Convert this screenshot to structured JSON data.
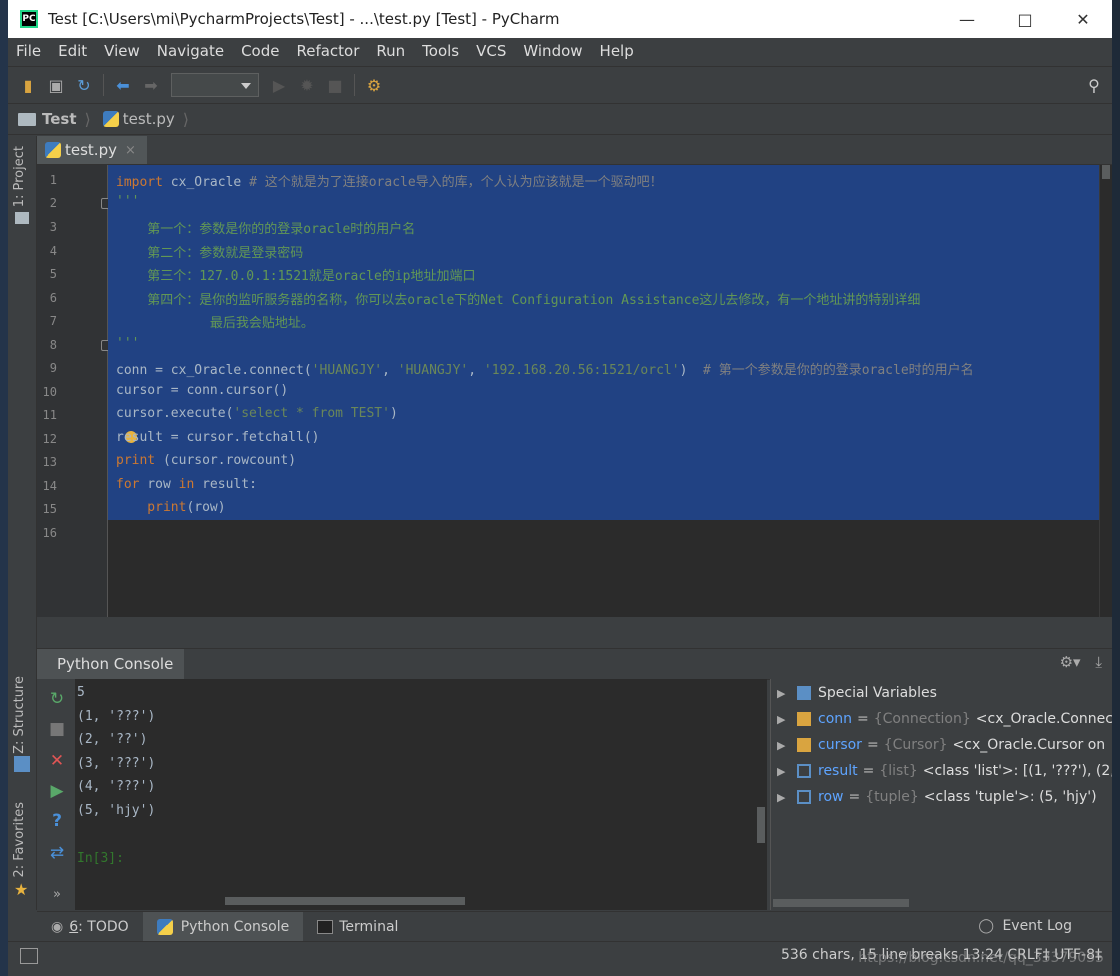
{
  "window": {
    "title": "Test [C:\\Users\\mi\\PycharmProjects\\Test] - ...\\test.py [Test] - PyCharm",
    "app_icon": "pycharm-logo",
    "app_icon_text": "PC",
    "controls": [
      "minimize-icon",
      "maximize-icon",
      "close-icon"
    ]
  },
  "menu": [
    "File",
    "Edit",
    "View",
    "Navigate",
    "Code",
    "Refactor",
    "Run",
    "Tools",
    "VCS",
    "Window",
    "Help"
  ],
  "toolbar": {
    "icons": [
      "open-folder-icon",
      "save-icon",
      "sync-icon",
      "back-arrow-icon",
      "forward-arrow-icon",
      "run-config-dropdown",
      "run-icon",
      "debug-icon",
      "stop-icon",
      "settings-icon",
      "search-icon"
    ]
  },
  "breadcrumb": {
    "project": "Test",
    "file": "test.py"
  },
  "left_strip": {
    "project_tab": "1: Project",
    "structure_tab": "Z: Structure",
    "favorites_tab": "2: Favorites"
  },
  "editor": {
    "tab_label": "test.py",
    "tab_close": "×",
    "line_numbers": [
      "1",
      "2",
      "3",
      "4",
      "5",
      "6",
      "7",
      "8",
      "9",
      "10",
      "11",
      "12",
      "13",
      "14",
      "15",
      "16"
    ],
    "lines": {
      "l1_kw": "import",
      "l1_code": " cx_Oracle ",
      "l1_comment": "# 这个就是为了连接oracle导入的库，个人认为应该就是一个驱动吧！",
      "l2": "'''",
      "l3": "    第一个：参数是你的的登录oracle时的用户名",
      "l4": "    第二个：参数就是登录密码",
      "l5": "    第三个：127.0.0.1:1521就是oracle的ip地址加端口",
      "l6": "    第四个：是你的监听服务器的名称，你可以去oracle下的Net Configuration Assistance这儿去修改，有一个地址讲的特别详细",
      "l7": "            最后我会贴地址。",
      "l8": "'''",
      "l9_code": "conn = cx_Oracle.connect(",
      "l9_s1": "'HUANGJY'",
      "l9_sep1": ", ",
      "l9_s2": "'HUANGJY'",
      "l9_sep2": ", ",
      "l9_s3": "'192.168.20.56:1521/orcl'",
      "l9_close": ")  ",
      "l9_comment": "# 第一个参数是你的的登录oracle时的用户名",
      "l10": "cursor = conn.cursor()",
      "l11_code": "cursor.execute(",
      "l11_str": "'select * from TEST'",
      "l11_close": ")",
      "l12": "result = cursor.fetchall()",
      "l13_kw": "print",
      "l13_code": " (cursor.rowcount)",
      "l14_kw1": "for",
      "l14_code1": " row ",
      "l14_kw2": "in",
      "l14_code2": " result:",
      "l15_kw": "    print",
      "l15_code": "(row)"
    }
  },
  "console": {
    "tab_label": "Python Console",
    "header_icons": [
      "gear-icon",
      "download-icon"
    ],
    "tool_icons": [
      "rerun-icon",
      "stop-icon",
      "close-icon",
      "run-icon",
      "help-icon",
      "settings-icon",
      "more-icon"
    ],
    "output": [
      "5",
      "(1, '???')",
      "(2, '??')",
      "(3, '???')",
      "(4, '???')",
      "(5, 'hjy')"
    ],
    "prompt": "In[3]:"
  },
  "variables": [
    {
      "name": "Special Variables",
      "type": "",
      "value": "",
      "icon": "special-vars-icon"
    },
    {
      "name": "conn",
      "type": "{Connection}",
      "value": "<cx_Oracle.Connec",
      "icon": "object-icon"
    },
    {
      "name": "cursor",
      "type": "{Cursor}",
      "value": "<cx_Oracle.Cursor on",
      "icon": "object-icon"
    },
    {
      "name": "result",
      "type": "{list}",
      "value": "<class 'list'>: [(1, '???'), (2, '",
      "icon": "list-icon"
    },
    {
      "name": "row",
      "type": "{tuple}",
      "value": "<class 'tuple'>: (5, 'hjy')",
      "icon": "list-icon"
    }
  ],
  "bottom_tabs": {
    "todo_num": "6",
    "todo_label": ": TODO",
    "console": "Python Console",
    "terminal": "Terminal",
    "event_log": "Event Log"
  },
  "status": {
    "text": "536 chars, 15 line breaks    13:24    CRLF‡    UTF-8‡",
    "watermark": "https://blog.csdn.net/qq_33379035"
  },
  "colors": {
    "selection": "#214283",
    "keyword": "#cc7832",
    "string": "#6a8759",
    "docstring": "#629755",
    "var_name": "#5ea4ff"
  }
}
